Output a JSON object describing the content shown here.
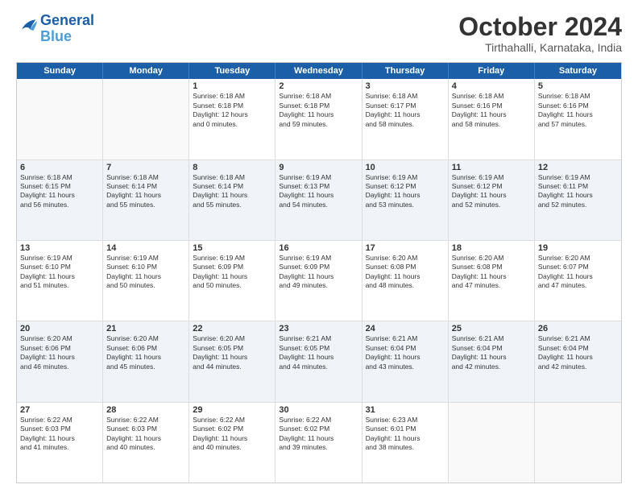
{
  "logo": {
    "line1": "General",
    "line2": "Blue"
  },
  "title": "October 2024",
  "location": "Tirthahalli, Karnataka, India",
  "header_days": [
    "Sunday",
    "Monday",
    "Tuesday",
    "Wednesday",
    "Thursday",
    "Friday",
    "Saturday"
  ],
  "rows": [
    [
      {
        "date": "",
        "info": ""
      },
      {
        "date": "",
        "info": ""
      },
      {
        "date": "1",
        "info": "Sunrise: 6:18 AM\nSunset: 6:18 PM\nDaylight: 12 hours\nand 0 minutes."
      },
      {
        "date": "2",
        "info": "Sunrise: 6:18 AM\nSunset: 6:18 PM\nDaylight: 11 hours\nand 59 minutes."
      },
      {
        "date": "3",
        "info": "Sunrise: 6:18 AM\nSunset: 6:17 PM\nDaylight: 11 hours\nand 58 minutes."
      },
      {
        "date": "4",
        "info": "Sunrise: 6:18 AM\nSunset: 6:16 PM\nDaylight: 11 hours\nand 58 minutes."
      },
      {
        "date": "5",
        "info": "Sunrise: 6:18 AM\nSunset: 6:16 PM\nDaylight: 11 hours\nand 57 minutes."
      }
    ],
    [
      {
        "date": "6",
        "info": "Sunrise: 6:18 AM\nSunset: 6:15 PM\nDaylight: 11 hours\nand 56 minutes."
      },
      {
        "date": "7",
        "info": "Sunrise: 6:18 AM\nSunset: 6:14 PM\nDaylight: 11 hours\nand 55 minutes."
      },
      {
        "date": "8",
        "info": "Sunrise: 6:18 AM\nSunset: 6:14 PM\nDaylight: 11 hours\nand 55 minutes."
      },
      {
        "date": "9",
        "info": "Sunrise: 6:19 AM\nSunset: 6:13 PM\nDaylight: 11 hours\nand 54 minutes."
      },
      {
        "date": "10",
        "info": "Sunrise: 6:19 AM\nSunset: 6:12 PM\nDaylight: 11 hours\nand 53 minutes."
      },
      {
        "date": "11",
        "info": "Sunrise: 6:19 AM\nSunset: 6:12 PM\nDaylight: 11 hours\nand 52 minutes."
      },
      {
        "date": "12",
        "info": "Sunrise: 6:19 AM\nSunset: 6:11 PM\nDaylight: 11 hours\nand 52 minutes."
      }
    ],
    [
      {
        "date": "13",
        "info": "Sunrise: 6:19 AM\nSunset: 6:10 PM\nDaylight: 11 hours\nand 51 minutes."
      },
      {
        "date": "14",
        "info": "Sunrise: 6:19 AM\nSunset: 6:10 PM\nDaylight: 11 hours\nand 50 minutes."
      },
      {
        "date": "15",
        "info": "Sunrise: 6:19 AM\nSunset: 6:09 PM\nDaylight: 11 hours\nand 50 minutes."
      },
      {
        "date": "16",
        "info": "Sunrise: 6:19 AM\nSunset: 6:09 PM\nDaylight: 11 hours\nand 49 minutes."
      },
      {
        "date": "17",
        "info": "Sunrise: 6:20 AM\nSunset: 6:08 PM\nDaylight: 11 hours\nand 48 minutes."
      },
      {
        "date": "18",
        "info": "Sunrise: 6:20 AM\nSunset: 6:08 PM\nDaylight: 11 hours\nand 47 minutes."
      },
      {
        "date": "19",
        "info": "Sunrise: 6:20 AM\nSunset: 6:07 PM\nDaylight: 11 hours\nand 47 minutes."
      }
    ],
    [
      {
        "date": "20",
        "info": "Sunrise: 6:20 AM\nSunset: 6:06 PM\nDaylight: 11 hours\nand 46 minutes."
      },
      {
        "date": "21",
        "info": "Sunrise: 6:20 AM\nSunset: 6:06 PM\nDaylight: 11 hours\nand 45 minutes."
      },
      {
        "date": "22",
        "info": "Sunrise: 6:20 AM\nSunset: 6:05 PM\nDaylight: 11 hours\nand 44 minutes."
      },
      {
        "date": "23",
        "info": "Sunrise: 6:21 AM\nSunset: 6:05 PM\nDaylight: 11 hours\nand 44 minutes."
      },
      {
        "date": "24",
        "info": "Sunrise: 6:21 AM\nSunset: 6:04 PM\nDaylight: 11 hours\nand 43 minutes."
      },
      {
        "date": "25",
        "info": "Sunrise: 6:21 AM\nSunset: 6:04 PM\nDaylight: 11 hours\nand 42 minutes."
      },
      {
        "date": "26",
        "info": "Sunrise: 6:21 AM\nSunset: 6:04 PM\nDaylight: 11 hours\nand 42 minutes."
      }
    ],
    [
      {
        "date": "27",
        "info": "Sunrise: 6:22 AM\nSunset: 6:03 PM\nDaylight: 11 hours\nand 41 minutes."
      },
      {
        "date": "28",
        "info": "Sunrise: 6:22 AM\nSunset: 6:03 PM\nDaylight: 11 hours\nand 40 minutes."
      },
      {
        "date": "29",
        "info": "Sunrise: 6:22 AM\nSunset: 6:02 PM\nDaylight: 11 hours\nand 40 minutes."
      },
      {
        "date": "30",
        "info": "Sunrise: 6:22 AM\nSunset: 6:02 PM\nDaylight: 11 hours\nand 39 minutes."
      },
      {
        "date": "31",
        "info": "Sunrise: 6:23 AM\nSunset: 6:01 PM\nDaylight: 11 hours\nand 38 minutes."
      },
      {
        "date": "",
        "info": ""
      },
      {
        "date": "",
        "info": ""
      }
    ]
  ]
}
